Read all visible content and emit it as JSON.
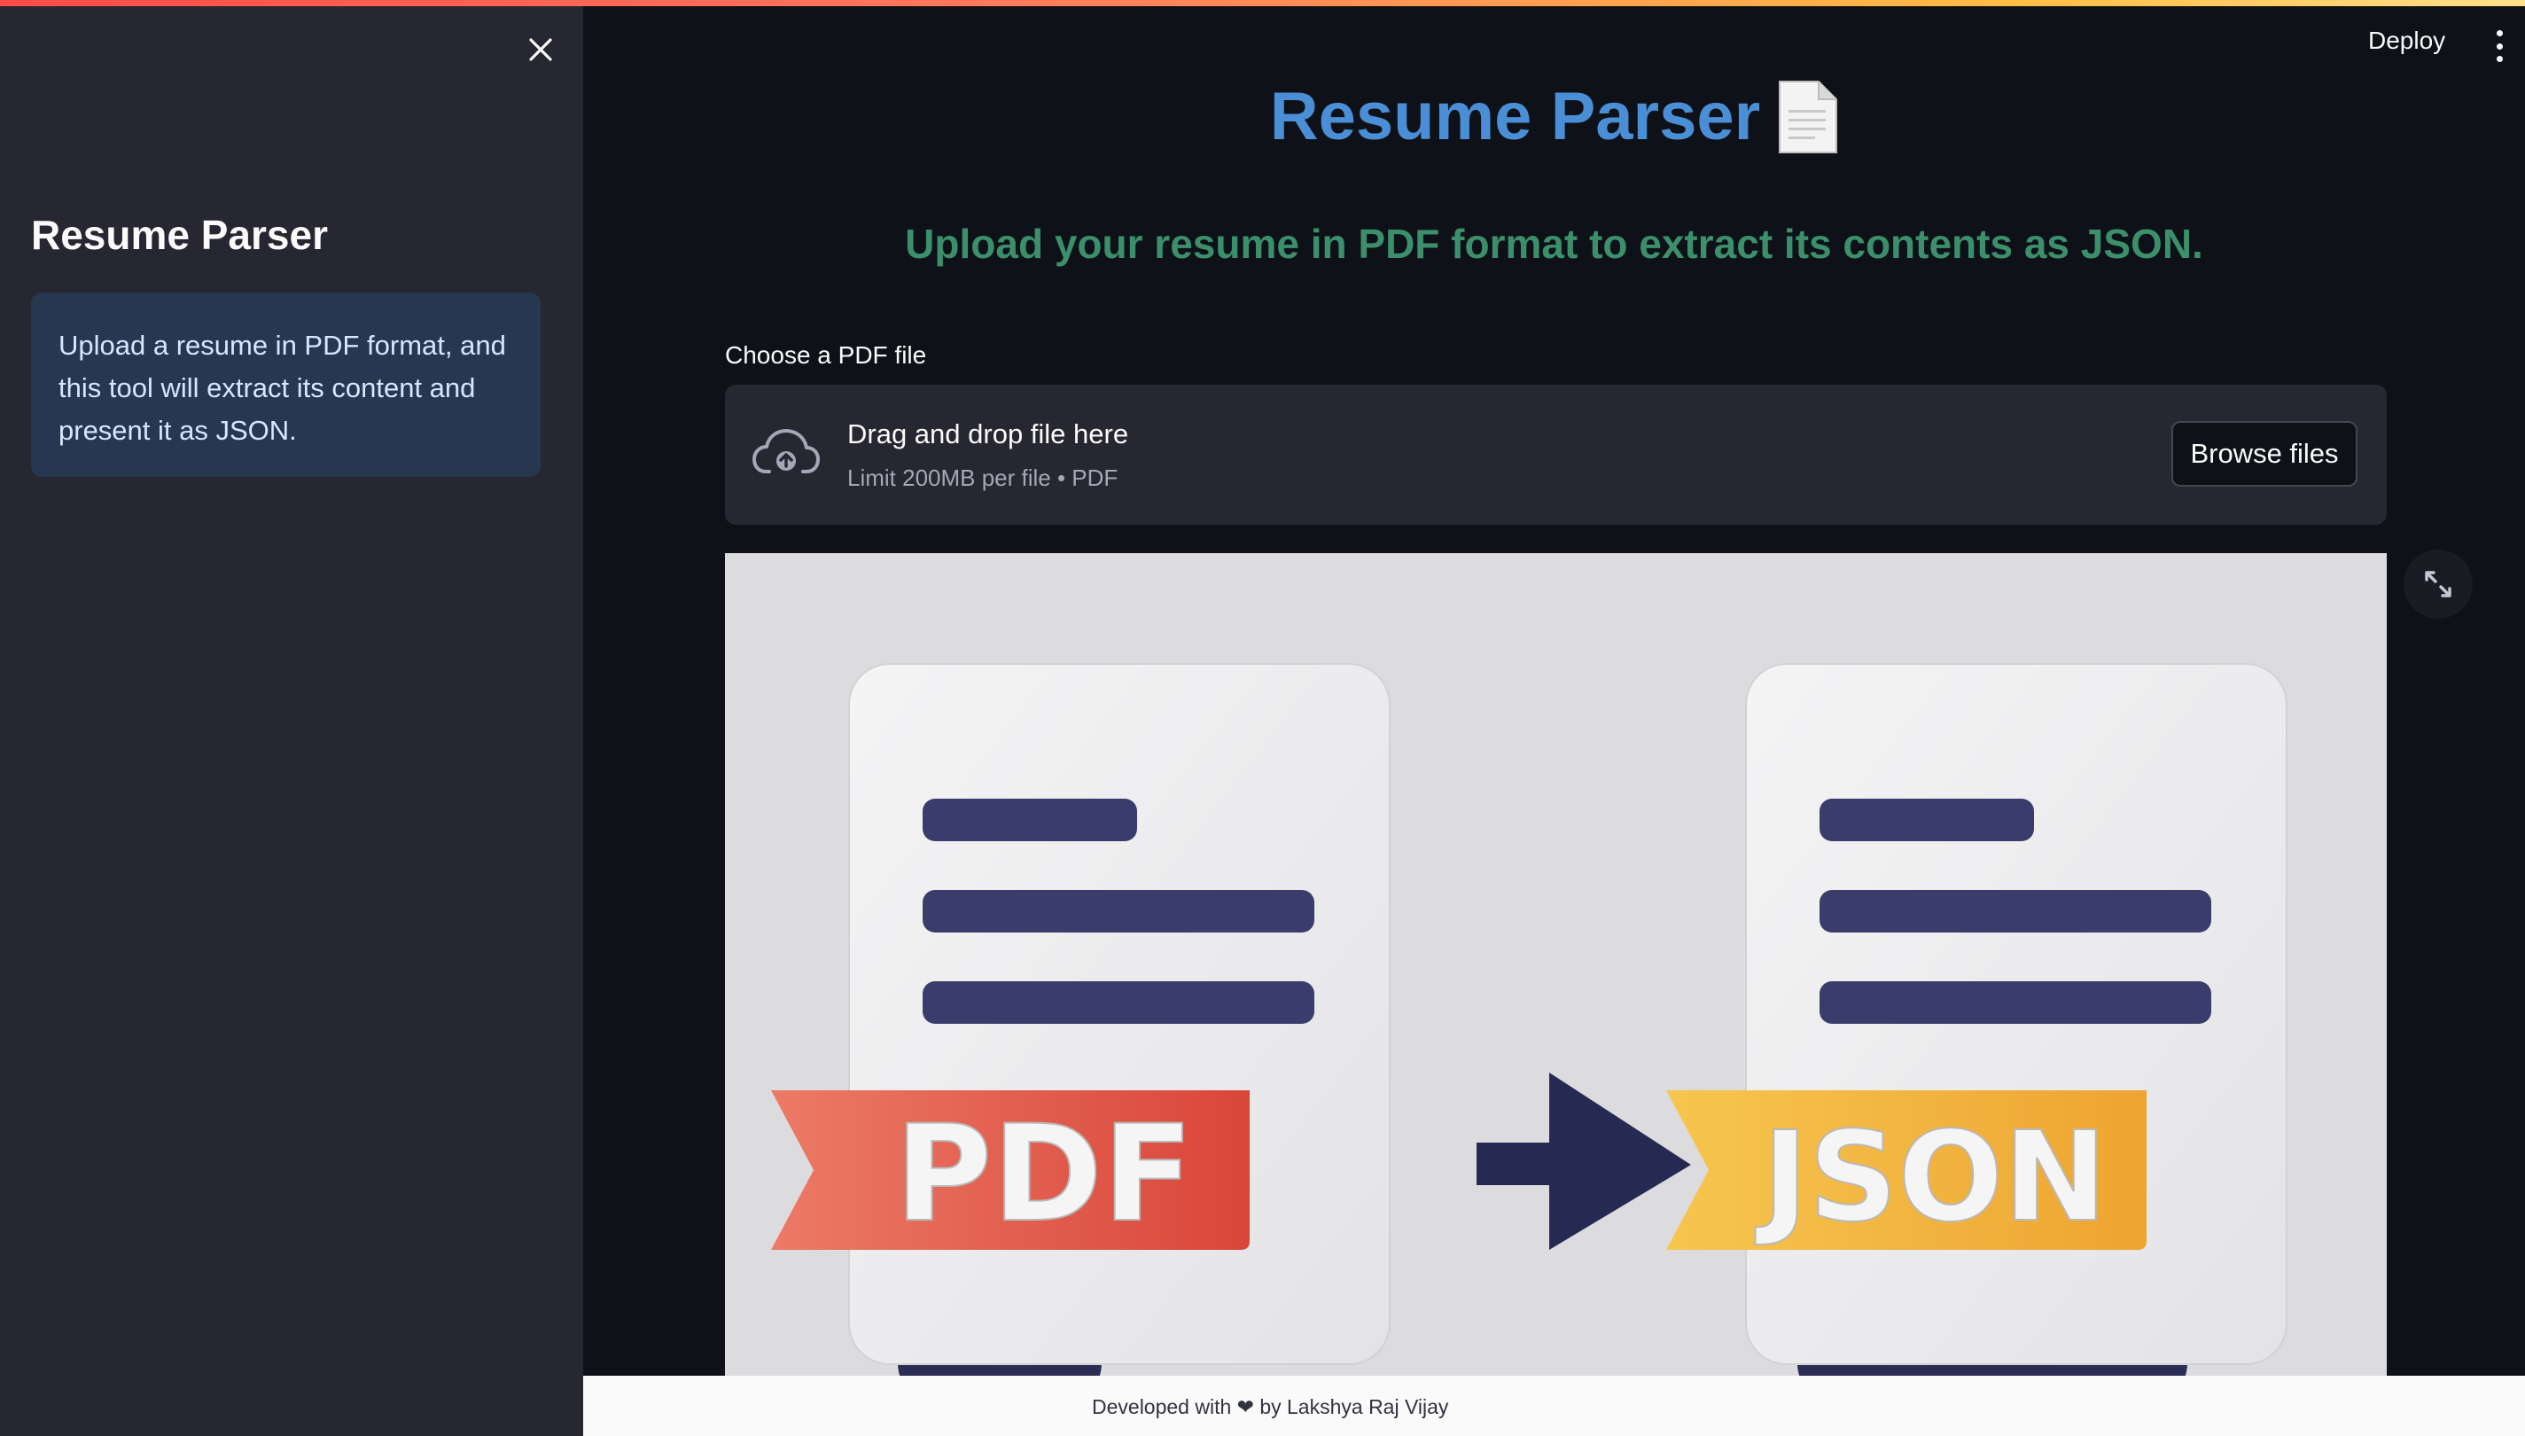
{
  "sidebar": {
    "title": "Resume Parser",
    "info": "Upload a resume in PDF format, and this tool will extract its content and present it as JSON.",
    "close_icon": "close-icon"
  },
  "header": {
    "deploy_label": "Deploy",
    "menu_icon": "more-vert-icon"
  },
  "main": {
    "title": "Resume Parser",
    "title_icon": "page-facing-up-emoji",
    "subtitle": "Upload your resume in PDF format to extract its contents as JSON.",
    "uploader": {
      "label": "Choose a PDF file",
      "drop_text": "Drag and drop file here",
      "limit_text": "Limit 200MB per file • PDF",
      "browse_label": "Browse files",
      "icon": "cloud-upload-icon"
    },
    "image": {
      "left_badge": "PDF",
      "right_badge": "JSON",
      "fullscreen_icon": "fullscreen-icon"
    }
  },
  "footer": {
    "prefix": "Developed with",
    "suffix": "by Lakshya Raj Vijay",
    "heart_icon": "heart-icon"
  },
  "colors": {
    "accent_title": "#4a8ed6",
    "subtitle": "#3b8f6b",
    "sidebar_bg": "#262730",
    "info_bg": "#263850",
    "pdf_red": "#e0503f",
    "json_yellow": "#f0b23c",
    "navy": "#272a4f"
  }
}
